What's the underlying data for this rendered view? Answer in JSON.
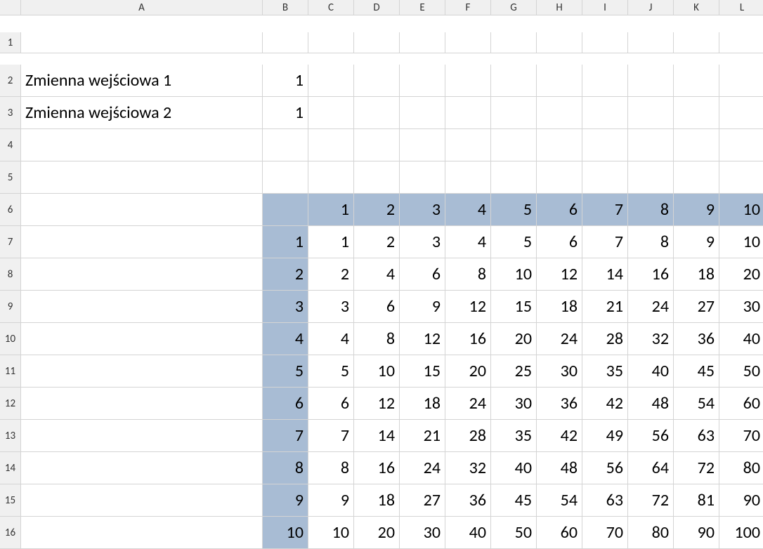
{
  "columns": [
    "A",
    "B",
    "C",
    "D",
    "E",
    "F",
    "G",
    "H",
    "I",
    "J",
    "K",
    "L"
  ],
  "rows": [
    "1",
    "2",
    "3",
    "4",
    "5",
    "6",
    "7",
    "8",
    "9",
    "10",
    "11",
    "12",
    "13",
    "14",
    "15",
    "16"
  ],
  "input1": {
    "label": "Zmienna wejściowa 1",
    "value": "1"
  },
  "input2": {
    "label": "Zmienna wejściowa 2",
    "value": "1"
  },
  "table": {
    "top_headers": [
      "1",
      "2",
      "3",
      "4",
      "5",
      "6",
      "7",
      "8",
      "9",
      "10"
    ],
    "left_headers": [
      "1",
      "2",
      "3",
      "4",
      "5",
      "6",
      "7",
      "8",
      "9",
      "10"
    ],
    "body": [
      [
        "1",
        "2",
        "3",
        "4",
        "5",
        "6",
        "7",
        "8",
        "9",
        "10"
      ],
      [
        "2",
        "4",
        "6",
        "8",
        "10",
        "12",
        "14",
        "16",
        "18",
        "20"
      ],
      [
        "3",
        "6",
        "9",
        "12",
        "15",
        "18",
        "21",
        "24",
        "27",
        "30"
      ],
      [
        "4",
        "8",
        "12",
        "16",
        "20",
        "24",
        "28",
        "32",
        "36",
        "40"
      ],
      [
        "5",
        "10",
        "15",
        "20",
        "25",
        "30",
        "35",
        "40",
        "45",
        "50"
      ],
      [
        "6",
        "12",
        "18",
        "24",
        "30",
        "36",
        "42",
        "48",
        "54",
        "60"
      ],
      [
        "7",
        "14",
        "21",
        "28",
        "35",
        "42",
        "49",
        "56",
        "63",
        "70"
      ],
      [
        "8",
        "16",
        "24",
        "32",
        "40",
        "48",
        "56",
        "64",
        "72",
        "80"
      ],
      [
        "9",
        "18",
        "27",
        "36",
        "45",
        "54",
        "63",
        "72",
        "81",
        "90"
      ],
      [
        "10",
        "20",
        "30",
        "40",
        "50",
        "60",
        "70",
        "80",
        "90",
        "100"
      ]
    ]
  }
}
